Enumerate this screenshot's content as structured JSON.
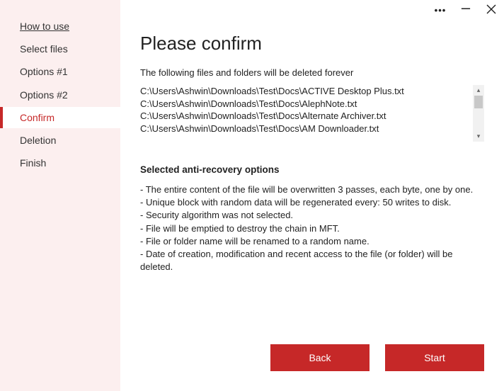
{
  "sidebar": {
    "items": [
      {
        "label": "How to use",
        "underline": true
      },
      {
        "label": "Select files"
      },
      {
        "label": "Options #1"
      },
      {
        "label": "Options #2"
      },
      {
        "label": "Confirm",
        "active": true
      },
      {
        "label": "Deletion"
      },
      {
        "label": "Finish"
      }
    ]
  },
  "main": {
    "heading": "Please confirm",
    "subhead": "The following files and folders will be deleted forever",
    "files": [
      "C:\\Users\\Ashwin\\Downloads\\Test\\Docs\\ACTIVE Desktop Plus.txt",
      "C:\\Users\\Ashwin\\Downloads\\Test\\Docs\\AlephNote.txt",
      "C:\\Users\\Ashwin\\Downloads\\Test\\Docs\\Alternate Archiver.txt",
      "C:\\Users\\Ashwin\\Downloads\\Test\\Docs\\AM Downloader.txt"
    ],
    "section_title": "Selected anti-recovery options",
    "options": [
      "- The entire content of the file will be overwritten 3 passes, each byte, one by one.",
      "- Unique block with random data will be regenerated every: 50 writes to disk.",
      "- Security algorithm was not selected.",
      "- File will be emptied to destroy the chain in MFT.",
      "- File or folder name will be renamed to a random name.",
      "- Date of creation, modification and recent access to the file (or folder) will be deleted."
    ]
  },
  "footer": {
    "back": "Back",
    "start": "Start"
  }
}
